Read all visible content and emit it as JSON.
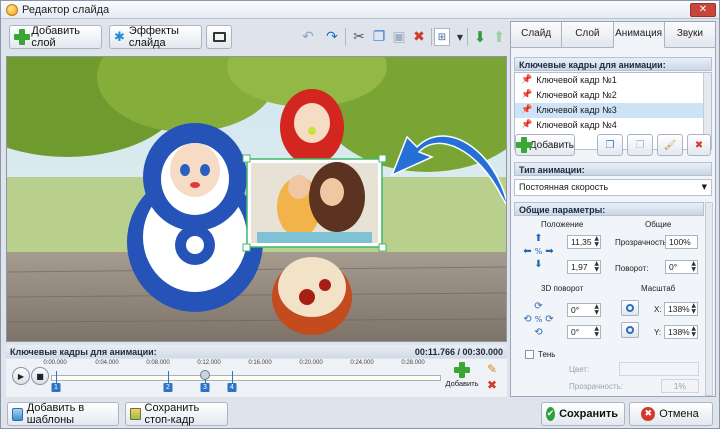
{
  "window": {
    "title": "Редактор слайда",
    "close_glyph": "✕"
  },
  "toolbar": {
    "add_layer": "Добавить слой",
    "slide_effects": "Эффекты слайда"
  },
  "timeline": {
    "header": "Ключевые кадры для анимации:",
    "time": "00:11.766 / 00:30.000",
    "ticks": [
      "0:00.000",
      "0:04.000",
      "0:08.000",
      "0:12.000",
      "0:16.000",
      "0:20.000",
      "0:24.000",
      "0:28.000"
    ],
    "keyframe_markers": [
      "1",
      "2",
      "3",
      "4"
    ],
    "add_label": "Добавить"
  },
  "bottom": {
    "add_to_templates": "Добавить в шаблоны",
    "save_frame": "Сохранить стоп-кадр",
    "save": "Сохранить",
    "cancel": "Отмена"
  },
  "panel": {
    "tabs": [
      "Слайд",
      "Слой",
      "Анимация",
      "Звуки"
    ],
    "active_tab": "Анимация",
    "kf_header": "Ключевые кадры для анимации:",
    "keyframes": [
      "Ключевой кадр №1",
      "Ключевой кадр №2",
      "Ключевой кадр №3",
      "Ключевой кадр №4"
    ],
    "selected_keyframe": 2,
    "add_label": "Добавить",
    "anim_type_header": "Тип анимации:",
    "anim_type_value": "Постоянная скорость",
    "params_header": "Общие параметры:",
    "position_label": "Положение",
    "general_label": "Общие",
    "pos_x": "11,35",
    "pos_y": "1,97",
    "opacity_label": "Прозрачность:",
    "opacity_value": "100%",
    "rotation_label": "Поворот:",
    "rotation_value": "0°",
    "rot3d_label": "3D поворот",
    "scale_label": "Масштаб",
    "rot3d_a": "0°",
    "rot3d_b": "0°",
    "scale_x_label": "X:",
    "scale_x": "138%",
    "scale_y_label": "Y:",
    "scale_y": "138%",
    "shadow_label": "Тень",
    "color_label": "Цвет:",
    "shadow_opacity_label": "Прозрачность:",
    "shadow_opacity_value": "1%"
  },
  "colors": {
    "accent": "#2b74c7",
    "selection": "#cfe3f7",
    "header_bg": "#cbd7e6"
  }
}
